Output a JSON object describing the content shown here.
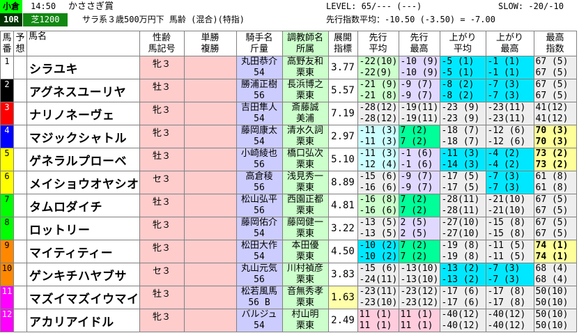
{
  "header": {
    "venue": "小倉",
    "time": "14:50",
    "race_title": "かささぎ賞",
    "level": "LEVEL: 65/--- (---)",
    "slow": "SLOW: -20/-10",
    "race_no": "10R",
    "course": "芝1200",
    "conditions": "サラ系３歳500万円下 馬齢 (混合)(特指)",
    "senko_avg": "先行指数平均：-10.50 (-3.50) = -7.00"
  },
  "columns": {
    "uma": [
      "馬",
      "番"
    ],
    "yoso": [
      "予",
      "想"
    ],
    "horse": "馬名",
    "sex": [
      "性齢",
      "馬記号"
    ],
    "odds": [
      "単勝",
      "複勝"
    ],
    "jockey": [
      "騎手名",
      "斤量"
    ],
    "trainer": [
      "調教師名",
      "所属"
    ],
    "tenkai": [
      "展開",
      "指標"
    ],
    "senko_avg": [
      "先行",
      "平均"
    ],
    "senko_max": [
      "先行",
      "最高"
    ],
    "agari_avg": [
      "上がり",
      "平均"
    ],
    "agari_max": [
      "上がり",
      "最高"
    ],
    "max_idx": [
      "最高",
      "指数"
    ]
  },
  "rows": [
    {
      "no": "1",
      "waku": "#ffffff",
      "name": "シラユキ",
      "sex": "牝３",
      "jockey": "丸田恭介",
      "weight": "54",
      "trainer": "高野友和",
      "region": "栗東",
      "idx": "3.77",
      "sa": [
        "-22(10)",
        "-22(9)"
      ],
      "sm": [
        "-10 (9)",
        "-10 (9)"
      ],
      "aa": [
        "-5 (1)",
        "-5 (1)"
      ],
      "am": [
        "-1 (1)",
        "-1 (1)"
      ],
      "mx": [
        "67 (5)",
        "67 (5)"
      ]
    },
    {
      "no": "2",
      "waku": "#000000",
      "name": "アグネスユーリヤ",
      "sex": "牡３",
      "jockey": "勝浦正樹",
      "weight": "56",
      "trainer": "長浜博之",
      "region": "栗東",
      "idx": "5.57",
      "sa": [
        "-21 (9)",
        "-21 (8)"
      ],
      "sm": [
        "-9 (7)",
        "-9 (7)"
      ],
      "aa": [
        "-8 (2)",
        "-8 (2)"
      ],
      "am": [
        "-7 (3)",
        "-7 (3)"
      ],
      "mx": [
        "67 (5)",
        "67 (5)"
      ]
    },
    {
      "no": "3",
      "waku": "#ff0000",
      "name": "ナリノネーヴェ",
      "sex": "牝３",
      "jockey": "吉田隼人",
      "weight": "54",
      "trainer": "斎藤誠",
      "region": "美浦",
      "idx": "7.19",
      "sa": [
        "-28(12)",
        "-28(12)"
      ],
      "sm": [
        "-19(11)",
        "-19(11)"
      ],
      "aa": [
        "-23 (9)",
        "-23 (9)"
      ],
      "am": [
        "-23(11)",
        "-23(11)"
      ],
      "mx": [
        "41(12)",
        "41(12)"
      ]
    },
    {
      "no": "4",
      "waku": "#0000ff",
      "name": "マジックシャトル",
      "sex": "牝３",
      "jockey": "藤岡康太",
      "weight": "54",
      "trainer": "清水久詞",
      "region": "栗東",
      "idx": "2.97",
      "sa": [
        "-11 (3)",
        "-11 (3)"
      ],
      "sm": [
        "7 (2)",
        "7 (2)"
      ],
      "aa": [
        "-18 (7)",
        "-18 (7)"
      ],
      "am": [
        "-12 (6)",
        "-12 (6)"
      ],
      "mx": [
        "70 (3)",
        "70 (3)"
      ]
    },
    {
      "no": "5",
      "waku": "#ffff00",
      "name": "ゲネラルプローベ",
      "sex": "牡３",
      "jockey": "小崎綾也",
      "weight": "56",
      "trainer": "橋口弘次",
      "region": "栗東",
      "idx": "5.10",
      "sa": [
        "-11 (3)",
        "-12 (4)"
      ],
      "sm": [
        "-1 (6)",
        "-1 (6)"
      ],
      "aa": [
        "-11 (3)",
        "-14 (3)"
      ],
      "am": [
        "-4 (2)",
        "-4 (2)"
      ],
      "mx": [
        "73 (2)",
        "73 (2)"
      ]
    },
    {
      "no": "6",
      "waku": "#ffff00",
      "name": "メイショウオヤシオ",
      "sex": "セ３",
      "jockey": "高倉稜",
      "weight": "56",
      "trainer": "浅見秀一",
      "region": "栗東",
      "idx": "8.89",
      "sa": [
        "-15 (6)",
        "-16 (6)"
      ],
      "sm": [
        "-9 (7)",
        "-9 (7)"
      ],
      "aa": [
        "-17 (5)",
        "-17 (5)"
      ],
      "am": [
        "-7 (3)",
        "-7 (3)"
      ],
      "mx": [
        "61 (8)",
        "61 (8)"
      ]
    },
    {
      "no": "7",
      "waku": "#00ff00",
      "name": "タムロダイチ",
      "sex": "牡３",
      "jockey": "松山弘平",
      "weight": "56",
      "trainer": "西園正都",
      "region": "栗東",
      "idx": "4.81",
      "sa": [
        "-16 (8)",
        "-16 (6)"
      ],
      "sm": [
        "7 (2)",
        "7 (2)"
      ],
      "aa": [
        "-28(11)",
        "-28(11)"
      ],
      "am": [
        "-21(10)",
        "-21(10)"
      ],
      "mx": [
        "67 (5)",
        "67 (5)"
      ]
    },
    {
      "no": "8",
      "waku": "#00ff00",
      "name": "ロットリー",
      "sex": "牝３",
      "jockey": "藤岡佑介",
      "weight": "54",
      "trainer": "藤岡健一",
      "region": "栗東",
      "idx": "3.22",
      "sa": [
        "-13 (5)",
        "-13 (5)"
      ],
      "sm": [
        "2 (5)",
        "2 (5)"
      ],
      "aa": [
        "-27(10)",
        "-27(10)"
      ],
      "am": [
        "-15 (8)",
        "-15 (8)"
      ],
      "mx": [
        "67 (5)",
        "67 (5)"
      ]
    },
    {
      "no": "9",
      "waku": "#ff8800",
      "name": "マイティティー",
      "sex": "牝３",
      "jockey": "松田大作",
      "weight": "54",
      "trainer": "本田優",
      "region": "栗東",
      "idx": "4.50",
      "sa": [
        "-10 (2)",
        "-10 (2)"
      ],
      "sm": [
        "7 (2)",
        "7 (2)"
      ],
      "aa": [
        "-19 (8)",
        "-19 (8)"
      ],
      "am": [
        "-11 (5)",
        "-11 (5)"
      ],
      "mx": [
        "74 (1)",
        "74 (1)"
      ]
    },
    {
      "no": "10",
      "waku": "#ff8800",
      "name": "ゲンキチハヤブサ",
      "sex": "セ３",
      "jockey": "丸山元気",
      "weight": "56",
      "trainer": "川村禎彦",
      "region": "栗東",
      "idx": "3.83",
      "sa": [
        "-15 (6)",
        "-24(11)"
      ],
      "sm": [
        "-13(10)",
        "-13(10)"
      ],
      "aa": [
        "-13 (2)",
        "-13 (2)"
      ],
      "am": [
        "-7 (3)",
        "-7 (3)"
      ],
      "mx": [
        "68 (4)",
        "68 (4)"
      ]
    },
    {
      "no": "11",
      "waku": "#ff00ff",
      "name": "マズイマズイウマイ",
      "sex": "牡３",
      "jockey": "松若風馬",
      "weight": "56 B",
      "trainer": "音無秀孝",
      "region": "栗東",
      "idx": "1.63",
      "sa": [
        "-23(11)",
        "-23(10)"
      ],
      "sm": [
        "-23(12)",
        "-23(12)"
      ],
      "aa": [
        "-17 (6)",
        "-17 (6)"
      ],
      "am": [
        "-17 (8)",
        "-17 (8)"
      ],
      "mx": [
        "50(10)",
        "50(10)"
      ]
    },
    {
      "no": "12",
      "waku": "#ff00ff",
      "name": "アカリアイドル",
      "sex": "牝３",
      "jockey": "バルジュ",
      "weight": "54",
      "trainer": "村山明",
      "region": "栗東",
      "idx": "2.49",
      "sa": [
        "11 (1)",
        "11 (1)"
      ],
      "sm": [
        "11 (1)",
        "11 (1)"
      ],
      "aa": [
        "-40(12)",
        "-40(12)"
      ],
      "am": [
        "-40(12)",
        "-40(12)"
      ],
      "mx": [
        "50(10)",
        "50(10)"
      ]
    }
  ]
}
